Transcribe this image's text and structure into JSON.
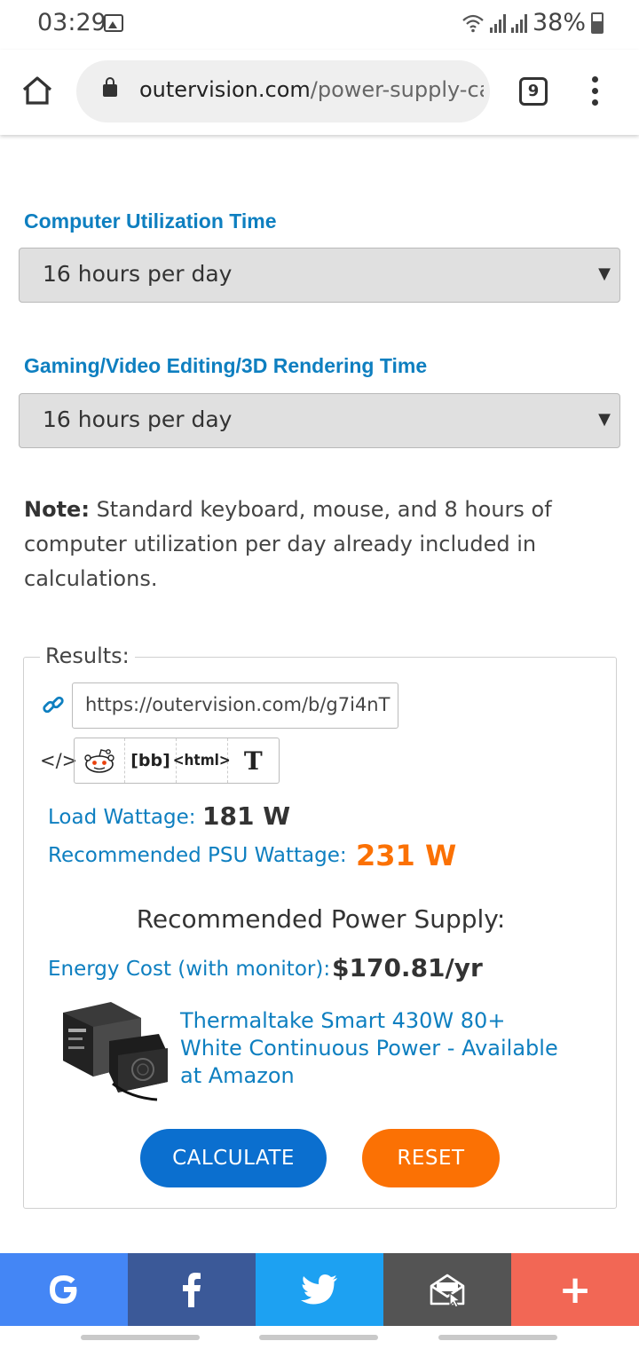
{
  "status_bar": {
    "time": "03:29",
    "battery": "38%",
    "icons": [
      "gallery-icon",
      "wifi-icon",
      "signal-icon",
      "battery-icon"
    ]
  },
  "browser": {
    "url_domain": "outervision.com",
    "url_path": "/power-supply-ca",
    "tab_count": "9",
    "icons": [
      "home-icon",
      "lock-icon",
      "tabs-icon",
      "menu-icon"
    ]
  },
  "form": {
    "utilization_label": "Computer Utilization Time",
    "utilization_value": "16 hours per day",
    "gaming_label": "Gaming/Video Editing/3D Rendering Time",
    "gaming_value": "16 hours per day"
  },
  "note": {
    "label": "Note:",
    "text": "Standard keyboard, mouse, and 8 hours of computer utilization per day already included in calculations."
  },
  "results": {
    "legend": "Results:",
    "share_url": "https://outervision.com/b/g7i4nT",
    "share_buttons": {
      "bb": "[bb]",
      "html": "<html>",
      "text": "T"
    },
    "load_label": "Load Wattage:",
    "load_value": "181 W",
    "psu_label": "Recommended PSU Wattage:",
    "psu_value": "231 W",
    "rec_title": "Recommended Power Supply:",
    "energy_label": "Energy Cost (with monitor):",
    "energy_value": "$170.81/yr",
    "product_link": "Thermaltake Smart 430W 80+ White Continuous Power - Available at Amazon",
    "calculate_label": "CALCULATE",
    "reset_label": "RESET"
  },
  "share_footer": {
    "buttons": [
      "google-icon",
      "facebook-icon",
      "twitter-icon",
      "email-icon",
      "more-icon"
    ],
    "more_symbol": "+"
  },
  "colors": {
    "link_blue": "#0e7fc0",
    "psu_orange": "#fb7104",
    "calculate_blue": "#0b6fcf",
    "google": "#4486f5",
    "facebook": "#3b5998",
    "twitter": "#1da1f2",
    "email": "#545454",
    "more": "#f26755"
  }
}
